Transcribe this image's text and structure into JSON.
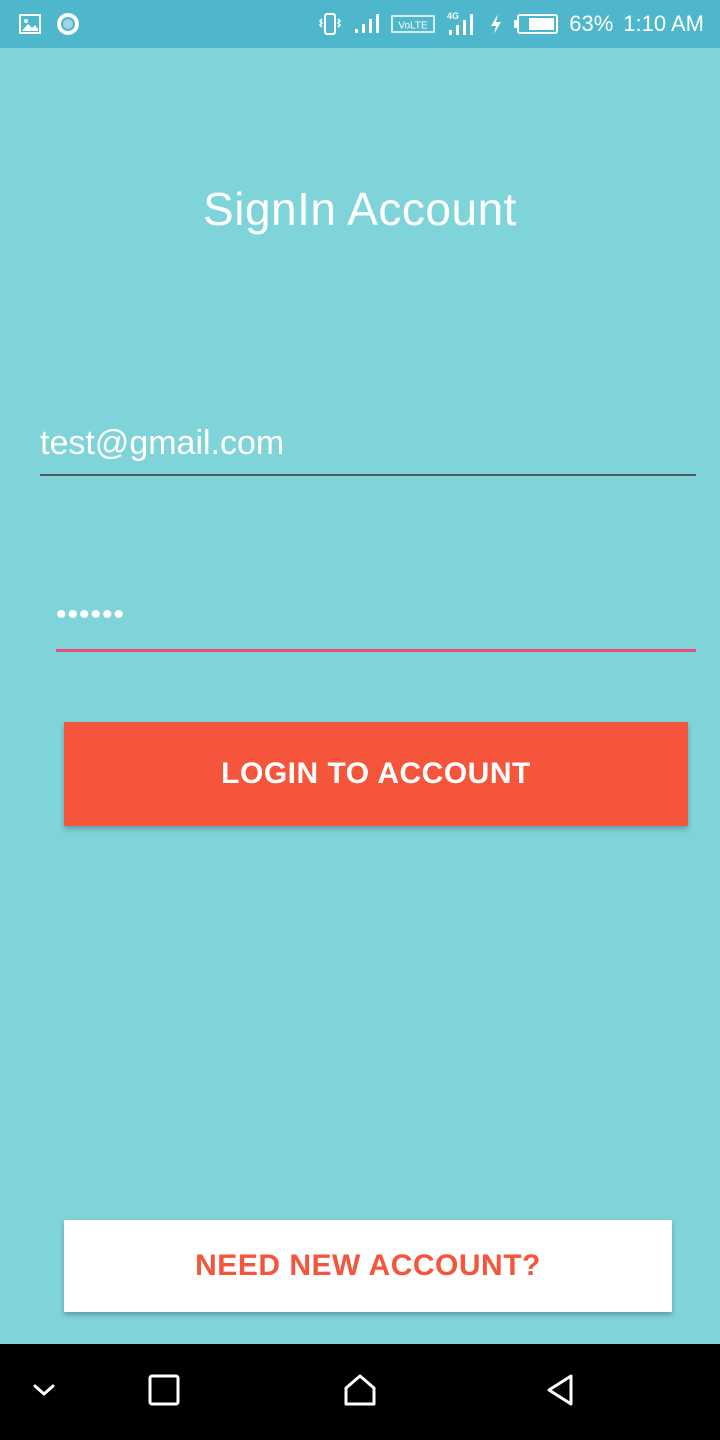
{
  "status_bar": {
    "battery_percent": "63%",
    "time": "1:10 AM",
    "network_label": "VoLTE",
    "network_type": "4G",
    "icons": [
      "image-icon",
      "circle-notification-icon",
      "vibrate-icon",
      "signal-icon",
      "volte-icon",
      "4g-signal-icon",
      "charging-icon",
      "battery-icon"
    ]
  },
  "page": {
    "title": "SignIn Account"
  },
  "form": {
    "email_value": "test@gmail.com",
    "password_value": "••••••",
    "login_label": "LOGIN TO ACCOUNT"
  },
  "footer": {
    "signup_label": "NEED NEW ACCOUNT?"
  },
  "nav_bar": {
    "icons": [
      "chevron-down-icon",
      "recents-square-icon",
      "home-icon",
      "back-triangle-icon"
    ]
  },
  "colors": {
    "background": "#7fd4da",
    "status_bar": "#4fb7cc",
    "accent_orange": "#f4553b",
    "focus_pink": "#ea4c7f",
    "nav_bar": "#000000"
  }
}
